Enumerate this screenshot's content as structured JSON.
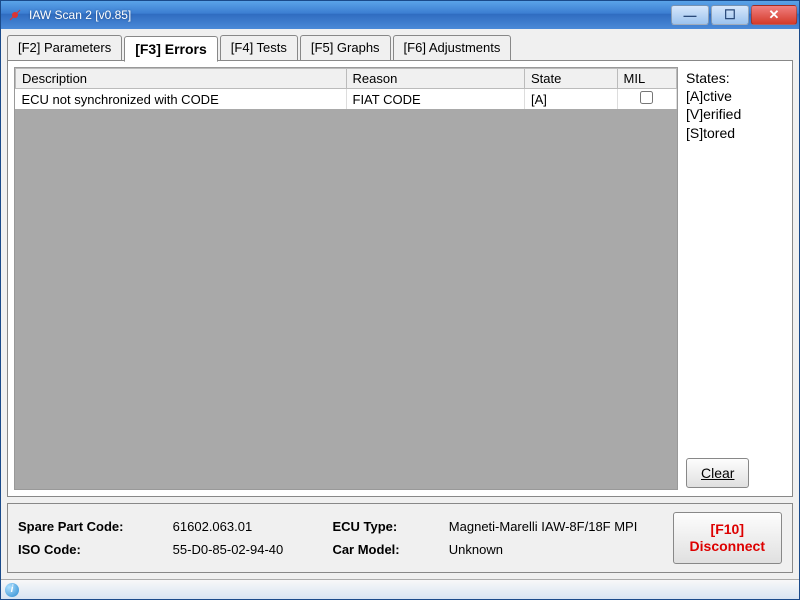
{
  "window": {
    "title": "IAW Scan 2 [v0.85]"
  },
  "tabs": [
    {
      "label": "[F2] Parameters"
    },
    {
      "label": "[F3] Errors"
    },
    {
      "label": "[F4] Tests"
    },
    {
      "label": "[F5] Graphs"
    },
    {
      "label": "[F6] Adjustments"
    }
  ],
  "active_tab": 1,
  "table": {
    "headers": {
      "description": "Description",
      "reason": "Reason",
      "state": "State",
      "mil": "MIL"
    },
    "rows": [
      {
        "description": "ECU not synchronized with CODE",
        "reason": "FIAT CODE",
        "state": "[A]",
        "mil": false
      }
    ]
  },
  "legend": {
    "title": "States:",
    "active": "[A]ctive",
    "verified": "[V]erified",
    "stored": "[S]tored"
  },
  "buttons": {
    "clear": "Clear",
    "disconnect_line1": "[F10]",
    "disconnect_line2": "Disconnect"
  },
  "footer": {
    "spare_part_label": "Spare Part Code:",
    "spare_part_value": "61602.063.01",
    "ecu_type_label": "ECU Type:",
    "ecu_type_value": "Magneti-Marelli IAW-8F/18F MPI",
    "iso_code_label": "ISO Code:",
    "iso_code_value": "55-D0-85-02-94-40",
    "car_model_label": "Car Model:",
    "car_model_value": "Unknown"
  }
}
